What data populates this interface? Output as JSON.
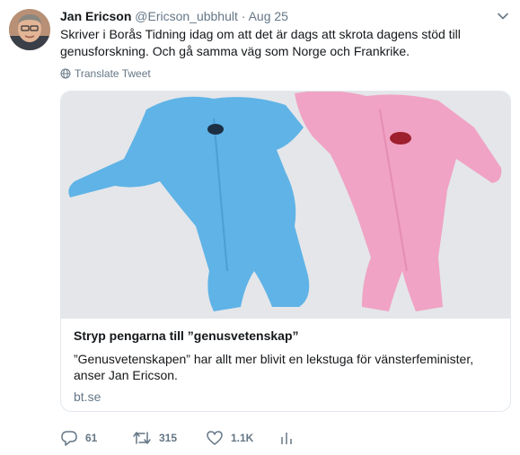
{
  "tweet": {
    "author_name": "Jan Ericson",
    "handle": "@Ericson_ubbhult",
    "separator": "·",
    "date": "Aug 25",
    "text": "Skriver i Borås Tidning idag om att det är dags att skrota dagens stöd till genusforskning. Och gå samma väg som Norge och Frankrike.",
    "translate_label": "Translate Tweet"
  },
  "card": {
    "title": "Stryp pengarna till ”genusvetenskap”",
    "description": "”Genusvetenskapen” har allt mer blivit en lekstuga för vänsterfeminister, anser Jan Ericson.",
    "domain": "bt.se"
  },
  "actions": {
    "replies": "61",
    "retweets": "315",
    "likes": "1.1K"
  },
  "icons": {
    "menu": "chevron-down-icon",
    "translate": "globe-icon",
    "reply": "reply-icon",
    "retweet": "retweet-icon",
    "like": "heart-icon",
    "analytics": "analytics-icon"
  },
  "colors": {
    "text": "#14171a",
    "secondary": "#657786",
    "border": "#e1e8ed",
    "onesie_blue": "#5fb3e6",
    "onesie_pink": "#f0a3c4"
  }
}
